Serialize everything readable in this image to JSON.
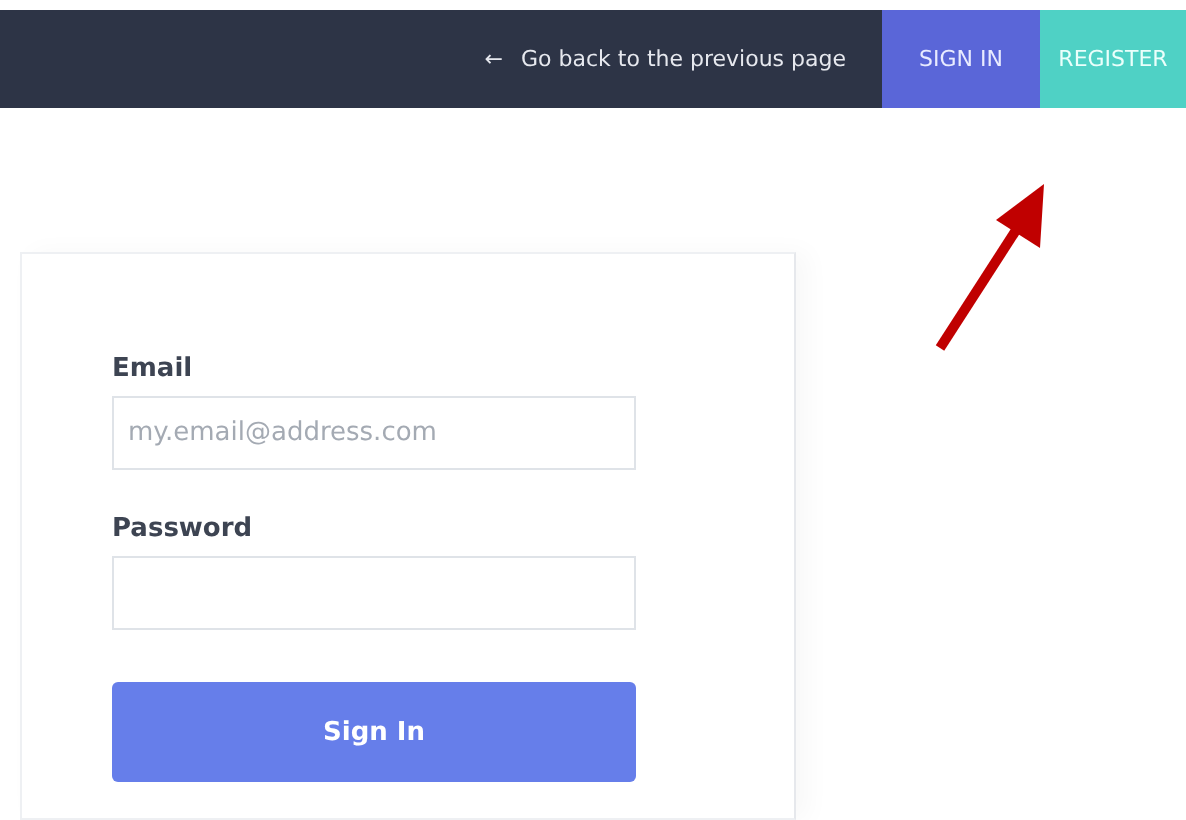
{
  "header": {
    "back_link": {
      "icon": "←",
      "label": "Go back to the previous page"
    },
    "nav_buttons": [
      {
        "label": "SIGN IN",
        "kind": "primary"
      },
      {
        "label": "REGISTER",
        "kind": "accent"
      }
    ]
  },
  "form": {
    "fields": [
      {
        "label": "Email",
        "placeholder": "my.email@address.com"
      },
      {
        "label": "Password"
      }
    ],
    "submit": "Sign In"
  },
  "annotation": {
    "kind": "arrow"
  }
}
